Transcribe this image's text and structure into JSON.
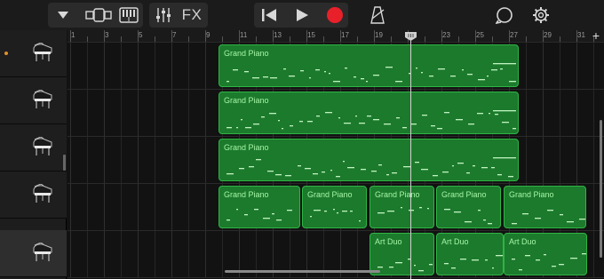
{
  "toolbar": {
    "fx_label": "FX",
    "icons": [
      "dropdown-icon",
      "browser-view-icon",
      "keyboard-icon",
      "mixer-icon",
      "fx",
      "rewind-icon",
      "play-icon",
      "record-icon",
      "metronome-icon",
      "loop-icon",
      "settings-icon"
    ],
    "record_color": "#e8202a"
  },
  "ruler": {
    "bar_labels": [
      "1",
      "3",
      "5",
      "7",
      "9",
      "11",
      "13",
      "15",
      "17",
      "19",
      "21",
      "23",
      "25",
      "27",
      "29",
      "31"
    ],
    "add_label": "+"
  },
  "tracks": [
    {
      "instrument": "grand-piano",
      "armed": true,
      "regions": [
        {
          "name": "Grand Piano"
        }
      ]
    },
    {
      "instrument": "grand-piano",
      "armed": false,
      "regions": [
        {
          "name": "Grand Piano"
        }
      ]
    },
    {
      "instrument": "grand-piano",
      "armed": false,
      "regions": [
        {
          "name": "Grand Piano"
        }
      ]
    },
    {
      "instrument": "grand-piano",
      "armed": false,
      "regions": [
        {
          "name": "Grand Piano"
        },
        {
          "name": "Grand Piano"
        },
        {
          "name": "Grand Piano"
        },
        {
          "name": "Grand Piano"
        },
        {
          "name": "Grand Piano"
        }
      ]
    },
    {
      "instrument": "grand-piano",
      "armed": false,
      "selected": true,
      "regions": [
        {
          "name": "Art Duo"
        },
        {
          "name": "Art Duo"
        },
        {
          "name": "Art Duo"
        }
      ]
    }
  ],
  "colors": {
    "region_fill": "#1c7a2c",
    "region_border": "#2fb445",
    "region_text": "#a6f5a8",
    "armed_dot": "#e0902b"
  }
}
